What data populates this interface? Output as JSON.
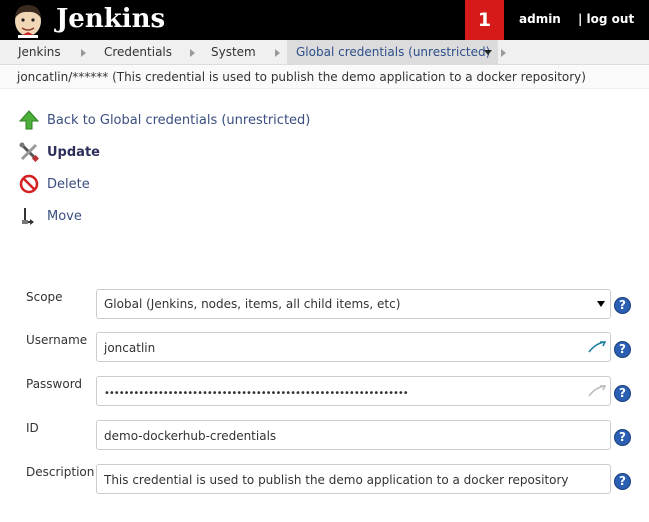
{
  "header": {
    "brand": "Jenkins",
    "notification_count": "1",
    "user": "admin",
    "logout": "| log out",
    "badge_color": "#d61a1a"
  },
  "breadcrumb": {
    "items": [
      "Jenkins",
      "Credentials",
      "System"
    ],
    "active": "Global credentials (unrestricted)"
  },
  "subtitle": "joncatlin/****** (This credential is used to publish the demo application to a docker repository)",
  "tasks": {
    "back": "Back to Global credentials (unrestricted)",
    "update": "Update",
    "delete": "Delete",
    "move": "Move"
  },
  "form": {
    "scope": {
      "label": "Scope",
      "value": "Global (Jenkins, nodes, items, all child items, etc)"
    },
    "username": {
      "label": "Username",
      "value": "joncatlin"
    },
    "password": {
      "label": "Password",
      "value": "••••••••••••••••••••••••••••••••••••••••••••••••••••••••••••••"
    },
    "id": {
      "label": "ID",
      "value": "demo-dockerhub-credentials"
    },
    "description": {
      "label": "Description",
      "value": "This credential is used to publish the demo application to a docker repository"
    },
    "help": "?"
  }
}
